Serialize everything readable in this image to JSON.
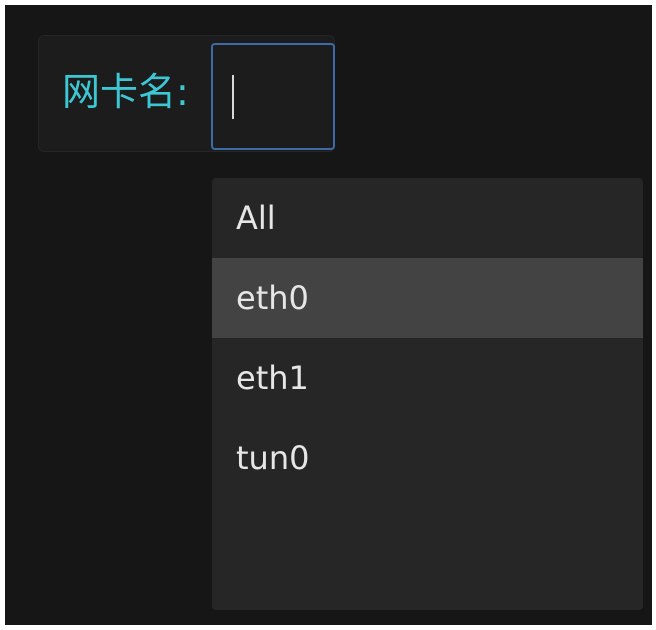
{
  "form": {
    "field_label": "网卡名:",
    "input_value": ""
  },
  "dropdown": {
    "options": [
      "All",
      "eth0",
      "eth1",
      "tun0"
    ],
    "highlighted_option": "eth0"
  },
  "colors": {
    "background": "#161616",
    "label_text": "#3dc6d3",
    "input_border_focus": "#3e6aa7",
    "dropdown_bg": "#262626",
    "option_highlight": "#434343",
    "option_text": "#e6e6e6"
  }
}
